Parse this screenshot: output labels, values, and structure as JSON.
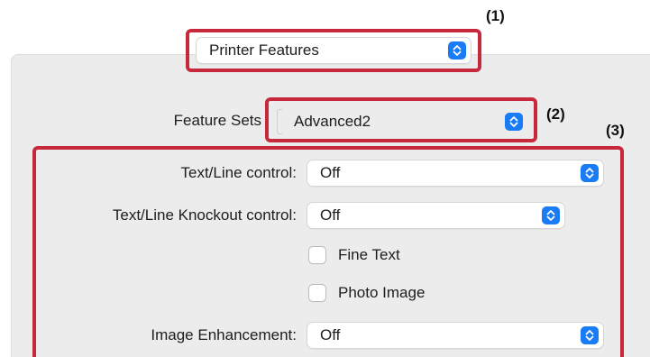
{
  "header": {
    "preset_popup": {
      "value": "Printer Features",
      "callout": "(1)"
    }
  },
  "feature_sets": {
    "label": "Feature Sets",
    "value": "Advanced2",
    "callout": "(2)"
  },
  "options": {
    "callout": "(3)",
    "text_line_control": {
      "label": "Text/Line control:",
      "value": "Off"
    },
    "text_line_knockout": {
      "label": "Text/Line Knockout control:",
      "value": "Off"
    },
    "fine_text": {
      "label": "Fine Text",
      "checked": false
    },
    "photo_image": {
      "label": "Photo Image",
      "checked": false
    },
    "image_enhancement": {
      "label": "Image Enhancement:",
      "value": "Off"
    }
  },
  "colors": {
    "highlight": "#c8283c",
    "accent": "#1a7cf5",
    "panel": "#ececec"
  },
  "icons": {
    "stepper": "chevron-up-down-icon"
  }
}
